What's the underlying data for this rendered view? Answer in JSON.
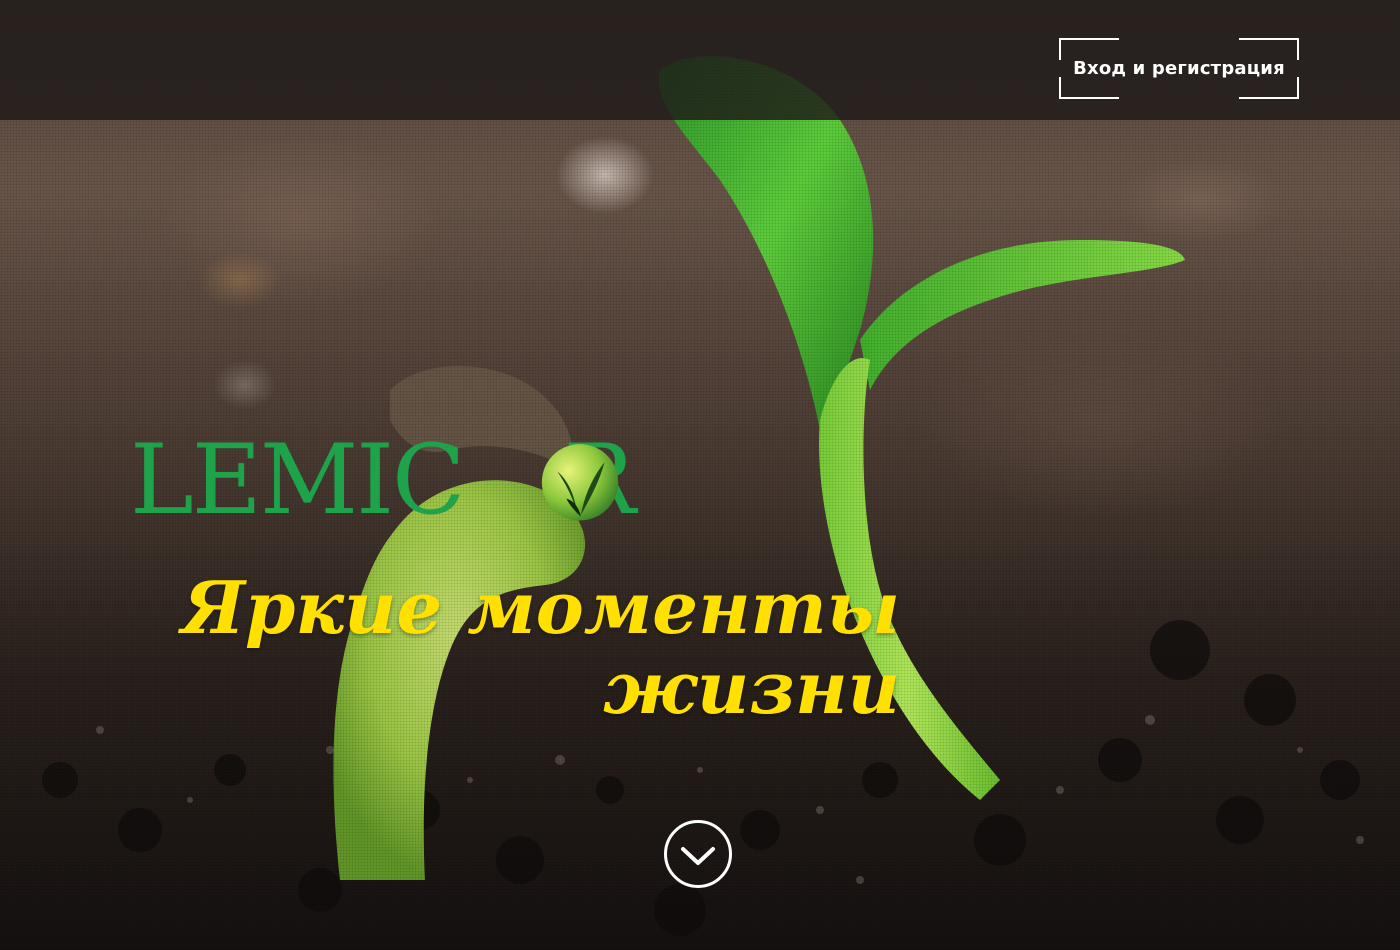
{
  "header": {
    "login_label": "Вход и регистрация"
  },
  "brand": {
    "logo_text_before": "LEMIC",
    "logo_text_after": "R",
    "logo_color": "#1fa34a"
  },
  "hero": {
    "slogan_line1": "Яркие моменты",
    "slogan_line2": "жизни",
    "slogan_color": "#ffe000"
  },
  "scroll": {
    "icon": "chevron-down-icon"
  }
}
